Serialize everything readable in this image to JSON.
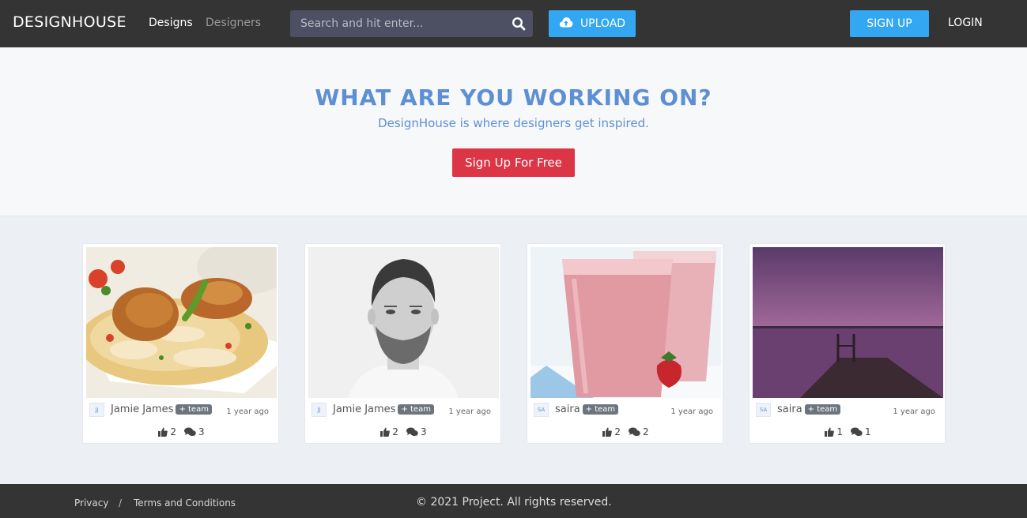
{
  "nav": {
    "brand": "DESIGNHOUSE",
    "links": [
      {
        "label": "Designs"
      },
      {
        "label": "Designers"
      }
    ],
    "search_placeholder": "Search and hit enter...",
    "upload_label": "UPLOAD",
    "signup_label": "SIGN UP",
    "login_label": "LOGIN"
  },
  "hero": {
    "title": "WHAT ARE YOU WORKING ON?",
    "subtitle": "DesignHouse is where designers get inspired.",
    "cta": "Sign Up For Free"
  },
  "designs": [
    {
      "image": "biryani-photo",
      "avatar": "JJ",
      "user": "Jamie James",
      "badge": "+ team",
      "time": "1 year ago",
      "likes": "2",
      "comments": "3"
    },
    {
      "image": "portrait-photo",
      "avatar": "JJ",
      "user": "Jamie James",
      "badge": "+ team",
      "time": "1 year ago",
      "likes": "2",
      "comments": "3"
    },
    {
      "image": "smoothie-photo",
      "avatar": "SA",
      "user": "saira",
      "badge": "+ team",
      "time": "1 year ago",
      "likes": "2",
      "comments": "2"
    },
    {
      "image": "dock-sunset-photo",
      "avatar": "SA",
      "user": "saira",
      "badge": "+ team",
      "time": "1 year ago",
      "likes": "1",
      "comments": "1"
    }
  ],
  "footer": {
    "privacy": "Privacy",
    "separator": "/",
    "terms": "Terms and Conditions",
    "copyright": "© 2021 Project. All rights reserved."
  },
  "colors": {
    "navbar_bg": "#343434",
    "accent_blue": "#33a7f2",
    "hero_text": "#5d8fd5",
    "cta_red": "#dc3545"
  }
}
